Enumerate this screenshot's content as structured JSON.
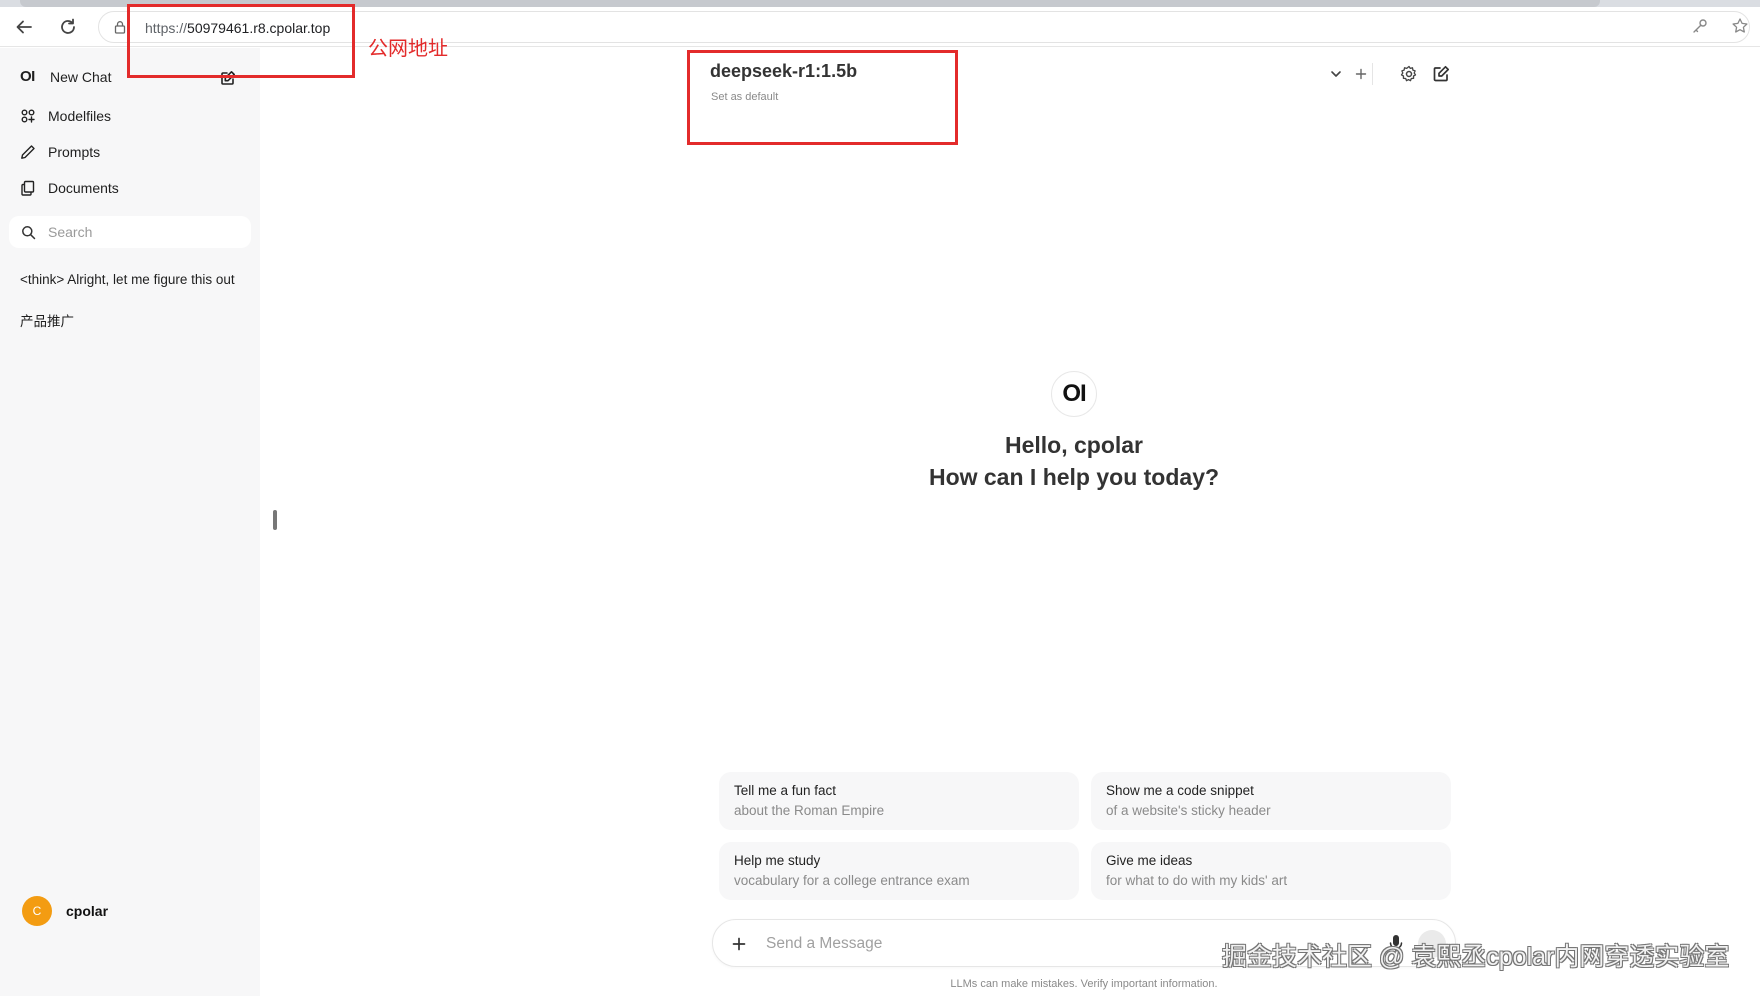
{
  "browser": {
    "url_scheme": "https://",
    "url_host": "50979461.r8.cpolar.top"
  },
  "annotation": {
    "public_address_label": "公网地址",
    "box_color": "#e32b2b"
  },
  "sidebar": {
    "new_chat": {
      "logo": "OI",
      "label": "New Chat"
    },
    "items": [
      {
        "label": "Modelfiles",
        "icon": "grid-icon"
      },
      {
        "label": "Prompts",
        "icon": "pencil-icon"
      },
      {
        "label": "Documents",
        "icon": "documents-icon"
      }
    ],
    "search": {
      "placeholder": "Search"
    },
    "history": [
      "<think> Alright, let me figure this out",
      "产品推广"
    ],
    "user": {
      "avatar_letter": "C",
      "name": "cpolar",
      "avatar_color": "#f39c12"
    }
  },
  "header": {
    "model_name": "deepseek-r1:1.5b",
    "set_default": "Set as default"
  },
  "welcome": {
    "logo": "OI",
    "greeting": "Hello, cpolar",
    "subtitle": "How can I help you today?"
  },
  "suggestions": [
    {
      "title": "Tell me a fun fact",
      "subtitle": "about the Roman Empire"
    },
    {
      "title": "Show me a code snippet",
      "subtitle": "of a website's sticky header"
    },
    {
      "title": "Help me study",
      "subtitle": "vocabulary for a college entrance exam"
    },
    {
      "title": "Give me ideas",
      "subtitle": "for what to do with my kids' art"
    }
  ],
  "message_input": {
    "placeholder": "Send a Message"
  },
  "disclaimer": "LLMs can make mistakes. Verify important information.",
  "watermark": "掘金技术社区 @ 袁熙丞cpolar内网穿透实验室"
}
